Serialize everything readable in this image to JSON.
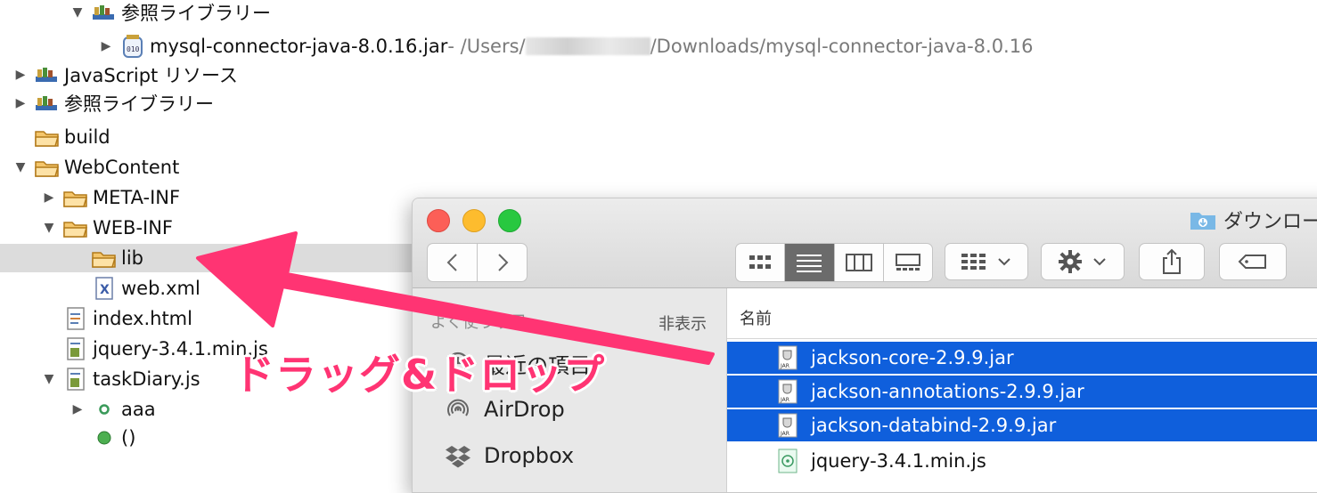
{
  "tree": {
    "items": [
      {
        "label": "参照ライブラリー"
      },
      {
        "label": "mysql-connector-java-8.0.16.jar",
        "path_prefix": " - /Users/",
        "path_suffix": "/Downloads/mysql-connector-java-8.0.16"
      },
      {
        "label": "JavaScript リソース"
      },
      {
        "label": "参照ライブラリー"
      },
      {
        "label": "build"
      },
      {
        "label": "WebContent"
      },
      {
        "label": "META-INF"
      },
      {
        "label": "WEB-INF"
      },
      {
        "label": "lib"
      },
      {
        "label": "web.xml"
      },
      {
        "label": "index.html"
      },
      {
        "label": "jquery-3.4.1.min.js"
      },
      {
        "label": "taskDiary.js"
      },
      {
        "label": "aaa"
      },
      {
        "label": "()"
      }
    ]
  },
  "finder": {
    "title": "ダウンロー",
    "sidebar": {
      "heading": "よく使う項目",
      "hide_label": "非表示",
      "items": [
        {
          "label": "最近の項目",
          "icon": "clock-icon"
        },
        {
          "label": "AirDrop",
          "icon": "airdrop-icon"
        },
        {
          "label": "Dropbox",
          "icon": "dropbox-icon"
        }
      ]
    },
    "column_header": "名前",
    "files": [
      {
        "name": "jackson-core-2.9.9.jar",
        "selected": true
      },
      {
        "name": "jackson-annotations-2.9.9.jar",
        "selected": true
      },
      {
        "name": "jackson-databind-2.9.9.jar",
        "selected": true
      },
      {
        "name": "jquery-3.4.1.min.js",
        "selected": false
      }
    ],
    "accent_color": "#0f5fdc"
  },
  "annotation": {
    "callout_text": "ドラッグ&ドロップ",
    "color": "#ff3473"
  }
}
